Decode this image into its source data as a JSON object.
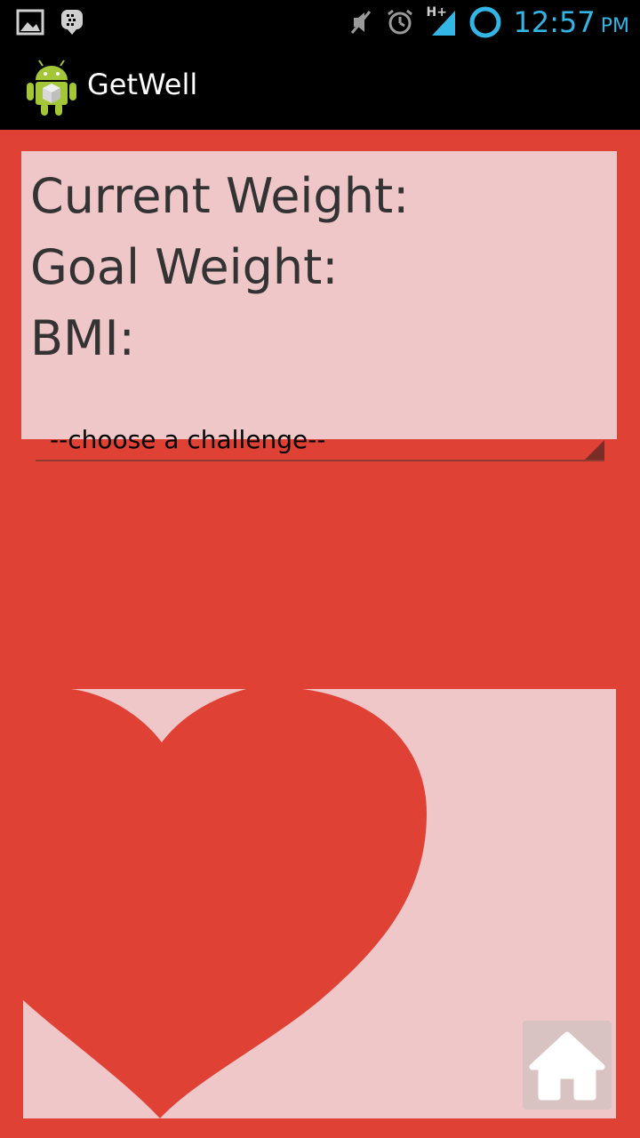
{
  "status_bar": {
    "time": "12:57",
    "ampm": "PM",
    "network_label": "H+",
    "icons": [
      "gallery-icon",
      "bbm-icon",
      "mute-icon",
      "alarm-icon",
      "signal-icon",
      "sync-icon"
    ]
  },
  "action_bar": {
    "title": "GetWell",
    "icon": "android-app-icon"
  },
  "info": {
    "current_weight_label": "Current Weight:",
    "goal_weight_label": "Goal Weight:",
    "bmi_label": "BMI:"
  },
  "challenge_spinner": {
    "selected": "--choose a challenge--"
  },
  "home_button": {
    "icon": "home-icon"
  },
  "colors": {
    "background": "#e04135",
    "panel": "#efc7c9",
    "heart": "#e04135",
    "clock": "#33b5e5",
    "text": "#333333"
  }
}
